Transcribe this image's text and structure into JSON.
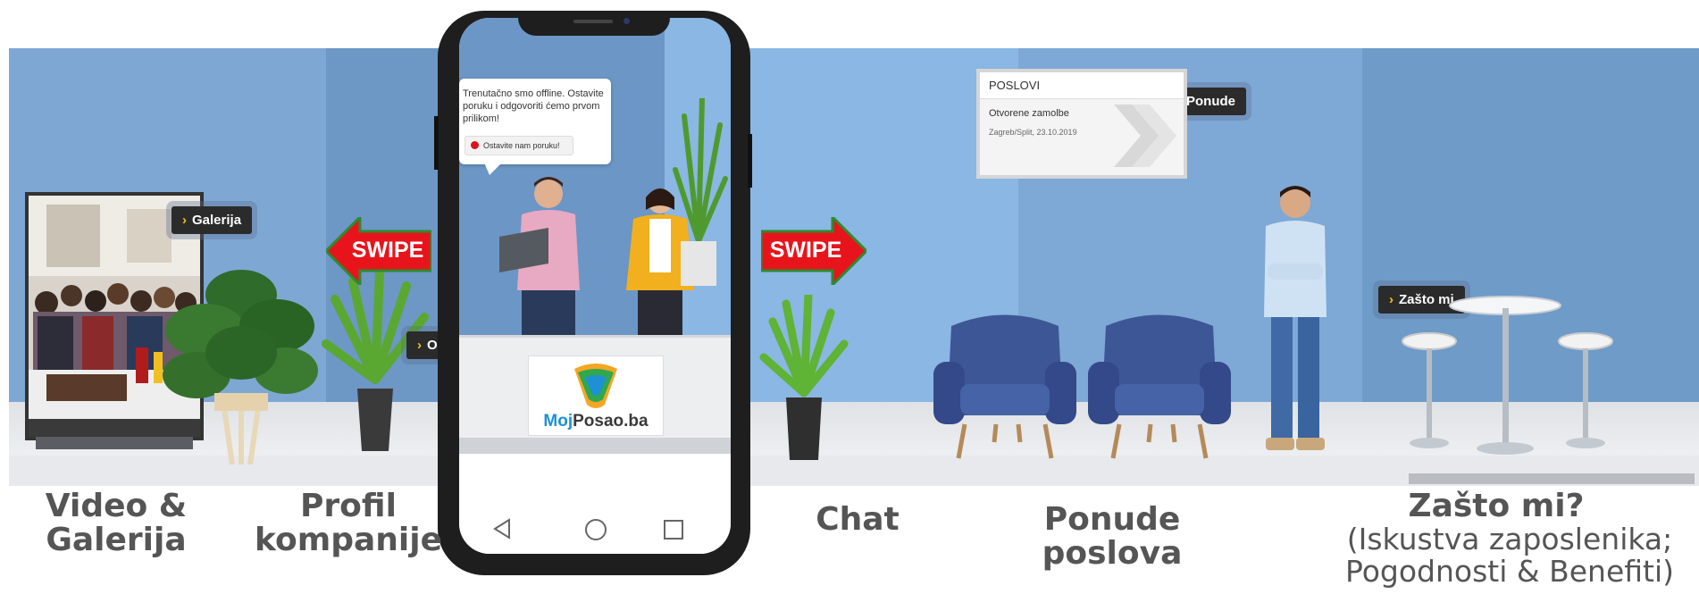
{
  "tags": {
    "galerija": "Galerija",
    "o_nama": "O nama",
    "ponude": "Ponude",
    "zasto_mi": "Zašto mi"
  },
  "swipe": {
    "left": "SWIPE",
    "right": "SWIPE"
  },
  "chat_bubble": {
    "message": "Trenutačno smo offline. Ostavite poruku i odgovoriti ćemo prvom prilikom!",
    "button": "Ostavite nam poruku!"
  },
  "job_card": {
    "header": "POSLOVI",
    "title": "Otvorene zamolbe",
    "subtitle": "Zagreb/Split, 23.10.2019"
  },
  "logo": {
    "text_moj": "Moj",
    "text_posao": "Posao.ba"
  },
  "captions": {
    "video_line1": "Video &",
    "video_line2": "Galerija",
    "profil_line1": "Profil",
    "profil_line2": "kompanije",
    "chat": "Chat",
    "ponude_line1": "Ponude",
    "ponude_line2": "poslova",
    "zasto_title": "Zašto mi?",
    "zasto_line1": "(Iskustva zaposlenika;",
    "zasto_line2": "Pogodnosti & Benefiti)"
  },
  "colors": {
    "wall_light": "#8fb6df",
    "wall_mid": "#6f9bc8",
    "wall_dark": "#5c84b3",
    "arrow_red": "#e8141c",
    "arrow_green": "#2f8a2f",
    "tag_bg": "#2b2b2b",
    "chev": "#f4c20d",
    "chair_blue": "#3d5796"
  }
}
